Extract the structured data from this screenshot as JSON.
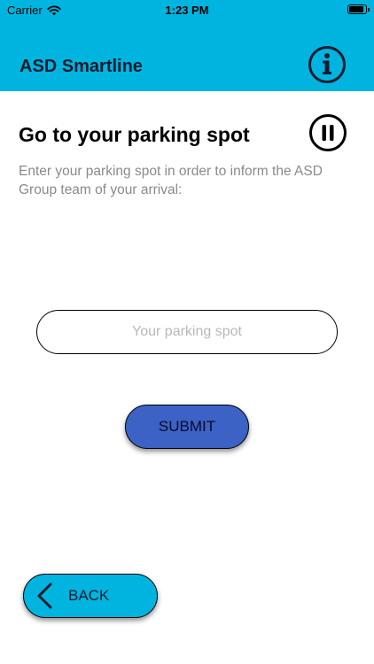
{
  "status_bar": {
    "carrier": "Carrier",
    "time": "1:23 PM"
  },
  "header": {
    "title": "ASD Smartline",
    "info_icon": "info-circle-icon",
    "background_color": "#00b4e0"
  },
  "main": {
    "title": "Go to your parking spot",
    "pause_icon": "pause-circle-icon",
    "description": "Enter your parking spot in order to inform the ASD Group team of your arrival:",
    "parking_input": {
      "value": "",
      "placeholder": "Your parking spot"
    },
    "submit_label": "SUBMIT",
    "submit_color": "#3b62c4"
  },
  "footer": {
    "back_label": "BACK",
    "back_icon": "chevron-left-icon",
    "back_color": "#00b4e0"
  }
}
